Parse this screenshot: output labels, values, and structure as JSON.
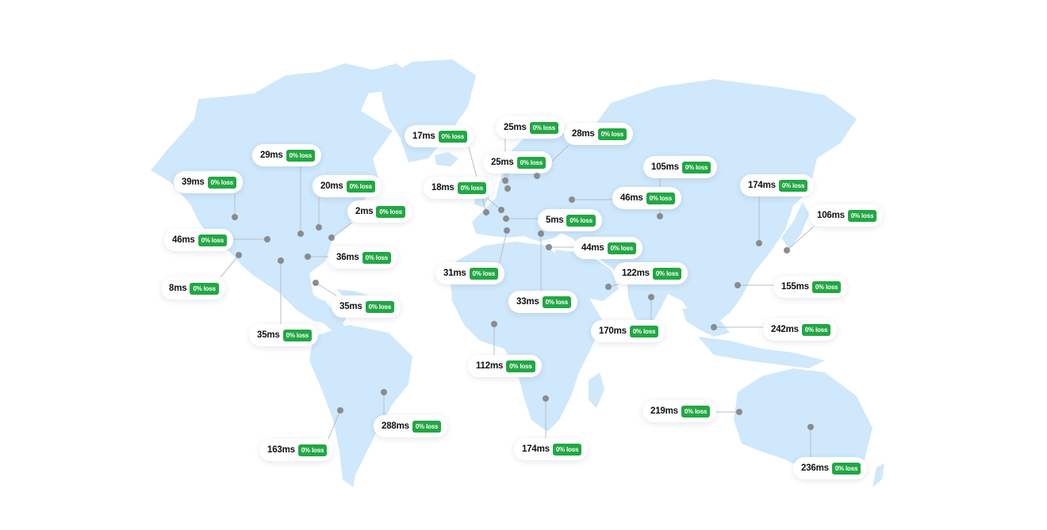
{
  "map": {
    "colors": {
      "land": "#cfe8fb",
      "dot": "#8a8c90",
      "badge": "#22a744",
      "line": "#b9bec4"
    },
    "markers": [
      {
        "latency": "29ms",
        "loss": "0% loss"
      },
      {
        "latency": "39ms",
        "loss": "0% loss"
      },
      {
        "latency": "20ms",
        "loss": "0% loss"
      },
      {
        "latency": "2ms",
        "loss": "0% loss"
      },
      {
        "latency": "46ms",
        "loss": "0% loss"
      },
      {
        "latency": "36ms",
        "loss": "0% loss"
      },
      {
        "latency": "8ms",
        "loss": "0% loss"
      },
      {
        "latency": "35ms",
        "loss": "0% loss"
      },
      {
        "latency": "35ms",
        "loss": "0% loss"
      },
      {
        "latency": "163ms",
        "loss": "0% loss"
      },
      {
        "latency": "288ms",
        "loss": "0% loss"
      },
      {
        "latency": "17ms",
        "loss": "0% loss"
      },
      {
        "latency": "25ms",
        "loss": "0% loss"
      },
      {
        "latency": "25ms",
        "loss": "0% loss"
      },
      {
        "latency": "28ms",
        "loss": "0% loss"
      },
      {
        "latency": "18ms",
        "loss": "0% loss"
      },
      {
        "latency": "5ms",
        "loss": "0% loss"
      },
      {
        "latency": "31ms",
        "loss": "0% loss"
      },
      {
        "latency": "44ms",
        "loss": "0% loss"
      },
      {
        "latency": "33ms",
        "loss": "0% loss"
      },
      {
        "latency": "112ms",
        "loss": "0% loss"
      },
      {
        "latency": "174ms",
        "loss": "0% loss"
      },
      {
        "latency": "105ms",
        "loss": "0% loss"
      },
      {
        "latency": "46ms",
        "loss": "0% loss"
      },
      {
        "latency": "122ms",
        "loss": "0% loss"
      },
      {
        "latency": "170ms",
        "loss": "0% loss"
      },
      {
        "latency": "174ms",
        "loss": "0% loss"
      },
      {
        "latency": "106ms",
        "loss": "0% loss"
      },
      {
        "latency": "155ms",
        "loss": "0% loss"
      },
      {
        "latency": "242ms",
        "loss": "0% loss"
      },
      {
        "latency": "219ms",
        "loss": "0% loss"
      },
      {
        "latency": "236ms",
        "loss": "0% loss"
      }
    ]
  }
}
